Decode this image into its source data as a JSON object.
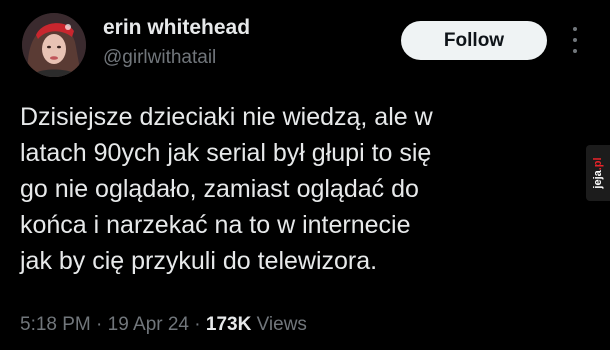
{
  "user": {
    "display_name": "erin whitehead",
    "handle": "@girlwithatail",
    "avatar_icon": "profile-photo"
  },
  "actions": {
    "follow_label": "Follow",
    "more_icon": "more-vertical-icon"
  },
  "tweet": {
    "lines": [
      "Dzisiejsze dzieciaki nie wiedzą, ale w",
      "latach 90ych jak serial był głupi to się",
      "go nie oglądało, zamiast oglądać do",
      "końca i narzekać na to w internecie",
      "jak by cię przykuli do telewizora."
    ]
  },
  "meta": {
    "time": "5:18 PM",
    "separator": "·",
    "date": "19 Apr 24",
    "views_count": "173K",
    "views_label": "Views"
  },
  "watermark": {
    "text": "jeja.pl"
  },
  "colors": {
    "background": "#000000",
    "primary_text": "#e7e9ea",
    "secondary_text": "#71767b",
    "follow_bg": "#eff3f4",
    "follow_text": "#0f1419"
  }
}
